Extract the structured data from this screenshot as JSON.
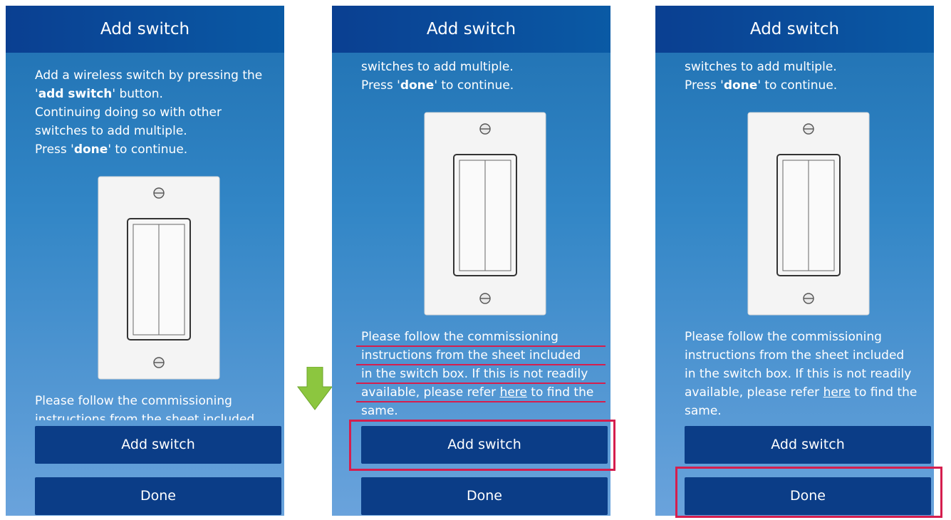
{
  "panels": [
    {
      "title": "Add switch",
      "instructions": {
        "p1": "Add a wireless switch by pressing the",
        "p2a": "'",
        "p2b": "add switch",
        "p2c": "' button.",
        "p3": "Continuing doing so with other",
        "p4": "switches to add multiple.",
        "p5a": "Press '",
        "p5b": "done",
        "p5c": "' to continue."
      },
      "commissioning": {
        "line1": "Please follow the commissioning",
        "line2": "instructions from the sheet included"
      },
      "buttons": {
        "add": "Add switch",
        "done": "Done"
      }
    },
    {
      "title": "Add switch",
      "instructions": {
        "p1": "switches to add multiple.",
        "p2a": "Press '",
        "p2b": "done",
        "p2c": "' to continue."
      },
      "commissioning": {
        "line1": "Please follow the commissioning",
        "line2": "instructions from the sheet included",
        "line3": "in the switch box. If this is not readily",
        "line4a": "available, please refer ",
        "link": "here",
        "line4b": " to find the",
        "line5": "same."
      },
      "buttons": {
        "add": "Add switch",
        "done": "Done"
      }
    },
    {
      "title": "Add switch",
      "instructions": {
        "p1": "switches to add multiple.",
        "p2a": "Press '",
        "p2b": "done",
        "p2c": "' to continue."
      },
      "commissioning": {
        "line1": "Please follow the commissioning",
        "line2": "instructions from the sheet included",
        "line3": "in the switch box. If this is not readily",
        "line4a": "available, please refer ",
        "link": "here",
        "line4b": " to find the",
        "line5": "same."
      },
      "buttons": {
        "add": "Add switch",
        "done": "Done"
      }
    }
  ],
  "colors": {
    "header": "#0a4a98",
    "button": "#0b3d87",
    "highlight": "#d51e4e",
    "arrow": "#8cc63f"
  },
  "icons": [
    "switch-plate-icon",
    "down-arrow-icon"
  ]
}
